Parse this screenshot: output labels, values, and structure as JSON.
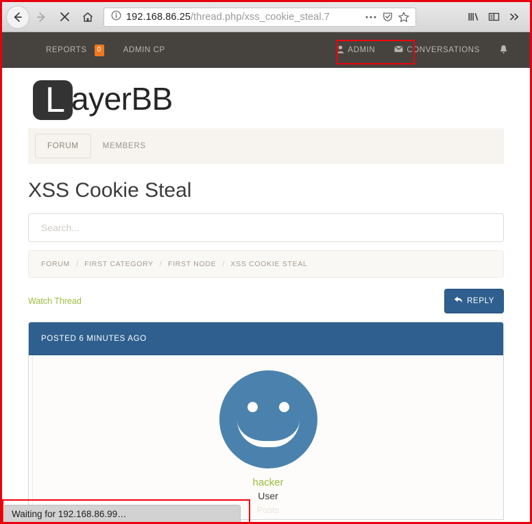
{
  "browser": {
    "back_label": "back-arrow",
    "forward_label": "forward-arrow",
    "stop_label": "stop-x",
    "home_label": "home",
    "url_host": "192.168.86.25",
    "url_path": "/thread.php/xss_cookie_steal.7",
    "url_full": "192.168.86.25/thread.php/xss_cookie_steal.7",
    "page_actions_label": "•••",
    "shield_label": "tracking-protection-shield",
    "bookmark_label": "bookmark-star",
    "library_label": "library",
    "sidebar_label": "sidebar",
    "overflow_label": "»"
  },
  "forum_nav": {
    "left_items": [
      {
        "label": "REPORTS",
        "badge": "0"
      },
      {
        "label": "ADMIN CP",
        "badge": ""
      }
    ],
    "right_items": [
      {
        "label": "ADMIN",
        "icon": "user-icon",
        "glyph": "👤"
      },
      {
        "label": "CONVERSATIONS",
        "icon": "envelope-icon",
        "glyph": "✉"
      }
    ],
    "bell_label": "notifications-bell",
    "badge_color": "#f0791f",
    "bar_color": "#46433f"
  },
  "brand": {
    "mark_letter": "L",
    "name_rest": "ayerBB",
    "mark_color": "#333333"
  },
  "tabs": [
    {
      "label": "FORUM",
      "active": true
    },
    {
      "label": "MEMBERS",
      "active": false
    }
  ],
  "thread": {
    "title": "XSS Cookie Steal",
    "watch_label": "Watch Thread",
    "reply_label": "REPLY",
    "reply_icon": "reply-arrow-icon",
    "accent_color": "#2e5f8f",
    "link_color": "#9bbd3f"
  },
  "search": {
    "value": "",
    "placeholder": "Search..."
  },
  "breadcrumb": {
    "separator": "/",
    "items": [
      "FORUM",
      "FIRST CATEGORY",
      "FIRST NODE",
      "XSS COOKIE STEAL"
    ]
  },
  "post": {
    "posted_label": "POSTED 6 MINUTES AGO",
    "author_name": "hacker",
    "author_rank": "User",
    "author_extra": "Posts",
    "avatar_label": "smiley-avatar",
    "avatar_color": "#4a82ad"
  },
  "status_bar": {
    "text": "Waiting for 192.168.86.99…"
  },
  "highlights": {
    "admin_box_color": "#f3000b",
    "status_box_color": "#f3000b",
    "page_border_color": "#e8000d"
  }
}
